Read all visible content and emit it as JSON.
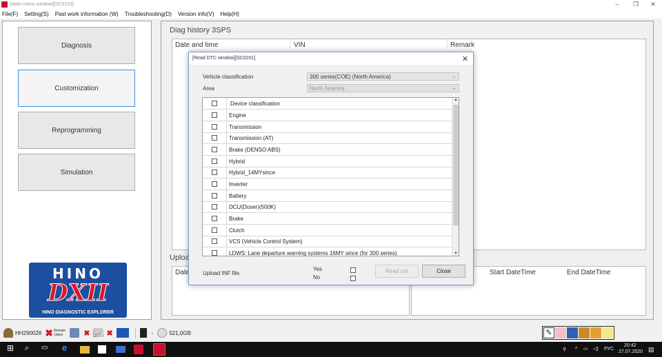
{
  "window": {
    "title": "[Main menu window][SC0103]"
  },
  "menubar": {
    "items": [
      "File(F)",
      "Setting(S)",
      "Past work information (W)",
      "Troubleshooting(D)",
      "Version info(V)",
      "Help(H)"
    ]
  },
  "nav": {
    "buttons": [
      "Diagnosis",
      "Customization",
      "Reprogramming",
      "Simulation"
    ],
    "active": "Customization"
  },
  "logo": {
    "brand": "HINO",
    "product": "DXII",
    "subtitle": "HINO DIAGNOSTIC EXPLORER"
  },
  "history": {
    "title": "Diag history 3SPS",
    "columns": [
      "Date and time",
      "VIN",
      "Remark"
    ]
  },
  "upload": {
    "title": "Uploa",
    "left_columns": [
      "Date"
    ],
    "right_columns": [
      "Start DateTime",
      "End DateTime"
    ]
  },
  "dialog": {
    "title": "[Read DTC window][SC0201]",
    "vehicle_classification_label": "Vehicle classification",
    "vehicle_classification_value": "300 series(COE) (North America)",
    "area_label": "Area",
    "area_value": "North America",
    "list_header": "Device classification",
    "devices": [
      "Engine",
      "Transmission",
      "Transmission (AT)",
      "Brake (DENSO ABS)",
      "Hybrid",
      "Hybrid_14MYsince",
      "Inverter",
      "Battery",
      "DCU(Doser)(500K)",
      "Brake",
      "Clutch",
      "VCS (Vehicle Control System)",
      "LDWS: Lane departure warning systems 16MY since (for 300 series)"
    ],
    "upload_inf_label": "Upload INF file.",
    "yes_label": "Yes",
    "no_label": "No",
    "read_out_label": "Read out",
    "close_label": "Close"
  },
  "statusbar": {
    "id": "HH290028",
    "remain": "Remain",
    "days": "1days",
    "dst": "DST-i",
    "disk": "521,0GB",
    "dash": "-"
  },
  "taskbar": {
    "time": "20:42",
    "date": "27.07.2020",
    "lang": "РУС"
  }
}
